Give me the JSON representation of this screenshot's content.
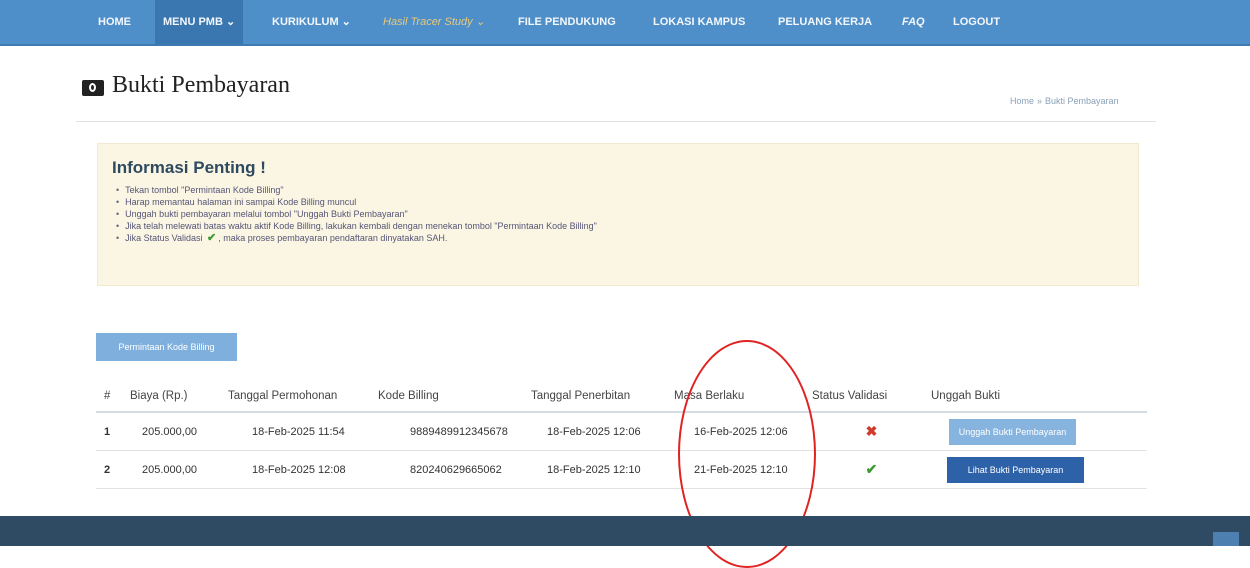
{
  "nav": {
    "items": [
      {
        "label": "HOME"
      },
      {
        "label": "MENU PMB ⌄"
      },
      {
        "label": "KURIKULUM ⌄"
      },
      {
        "label": "Hasil Tracer Study ⌄"
      },
      {
        "label": "FILE PENDUKUNG"
      },
      {
        "label": "LOKASI KAMPUS"
      },
      {
        "label": "PELUANG KERJA"
      },
      {
        "label": "FAQ"
      },
      {
        "label": "LOGOUT"
      }
    ]
  },
  "page": {
    "title": "Bukti Pembayaran",
    "title_icon": "money-icon"
  },
  "breadcrumb": {
    "home": "Home",
    "separator": "»",
    "current": "Bukti Pembayaran"
  },
  "info": {
    "title": "Informasi Penting !",
    "items": [
      "Tekan tombol \"Permintaan Kode Billing\"",
      "Harap memantau halaman ini sampai Kode Billing muncul",
      "Unggah bukti pembayaran melalui tombol \"Unggah Bukti Pembayaran\"",
      "Jika telah melewati batas waktu aktif Kode Billing, lakukan kembali dengan menekan tombol \"Permintaan Kode Billing\""
    ],
    "last_item_before": "Jika Status Validasi",
    "last_item_after": ", maka proses pembayaran pendaftaran dinyatakan SAH."
  },
  "actions": {
    "billing_button": "Permintaan Kode Billing"
  },
  "table": {
    "headers": [
      "#",
      "Biaya (Rp.)",
      "Tanggal Permohonan",
      "Kode Billing",
      "Tanggal Penerbitan",
      "Masa Berlaku",
      "Status Validasi",
      "Unggah Bukti"
    ],
    "rows": [
      {
        "no": "1",
        "biaya": "205.000,00",
        "tgl_permohonan": "18-Feb-2025 11:54",
        "kode": "9889489912345678",
        "tgl_penerbitan": "18-Feb-2025 12:06",
        "masa": "16-Feb-2025 12:06",
        "status": "invalid",
        "action": "Unggah Bukti Pembayaran"
      },
      {
        "no": "2",
        "biaya": "205.000,00",
        "tgl_permohonan": "18-Feb-2025 12:08",
        "kode": "820240629665062",
        "tgl_penerbitan": "18-Feb-2025 12:10",
        "masa": "21-Feb-2025 12:10",
        "status": "valid",
        "action": "Lihat Bukti Pembayaran"
      }
    ]
  },
  "colors": {
    "navbar": "#4f8fc9",
    "info_bg": "#fbf6e3",
    "invalid": "#d03a2f",
    "valid": "#3c9a32",
    "annotation_circle": "#e02222"
  }
}
